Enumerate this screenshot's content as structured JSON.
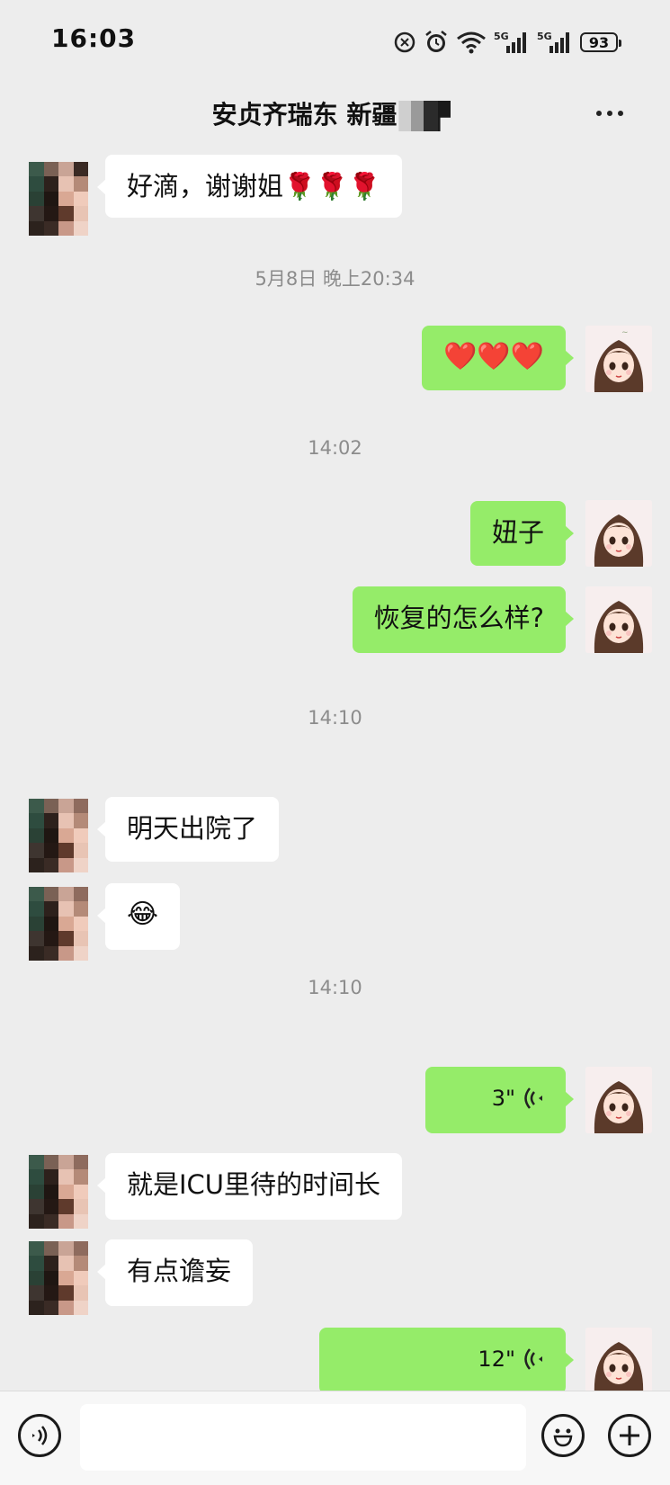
{
  "status_bar": {
    "time": "16:03",
    "network": "5G",
    "battery": "93"
  },
  "header": {
    "title": "安贞齐瑞东  新疆"
  },
  "messages": {
    "m1": "好滴，谢谢姐🌹🌹🌹",
    "ts1": "5月8日 晚上20:34",
    "m2": "❤️❤️❤️",
    "ts2": "14:02",
    "m3": "妞子",
    "m4": "恢复的怎么样?",
    "ts3": "14:10",
    "m5": "明天出院了",
    "m6": "😂",
    "ts4": "14:10",
    "m7": "3\"",
    "m8": "就是ICU里待的时间长",
    "m9": "有点谵妄",
    "m10": "12\""
  },
  "input_bar": {
    "placeholder": ""
  },
  "colors": {
    "outgoing_bubble": "#95ec69",
    "incoming_bubble": "#ffffff",
    "background": "#ededed"
  },
  "icons": [
    "alarm-icon",
    "wifi-icon",
    "signal-icon",
    "more-icon",
    "voice-input-icon",
    "emoji-icon",
    "add-icon",
    "voice-wave-icon"
  ]
}
